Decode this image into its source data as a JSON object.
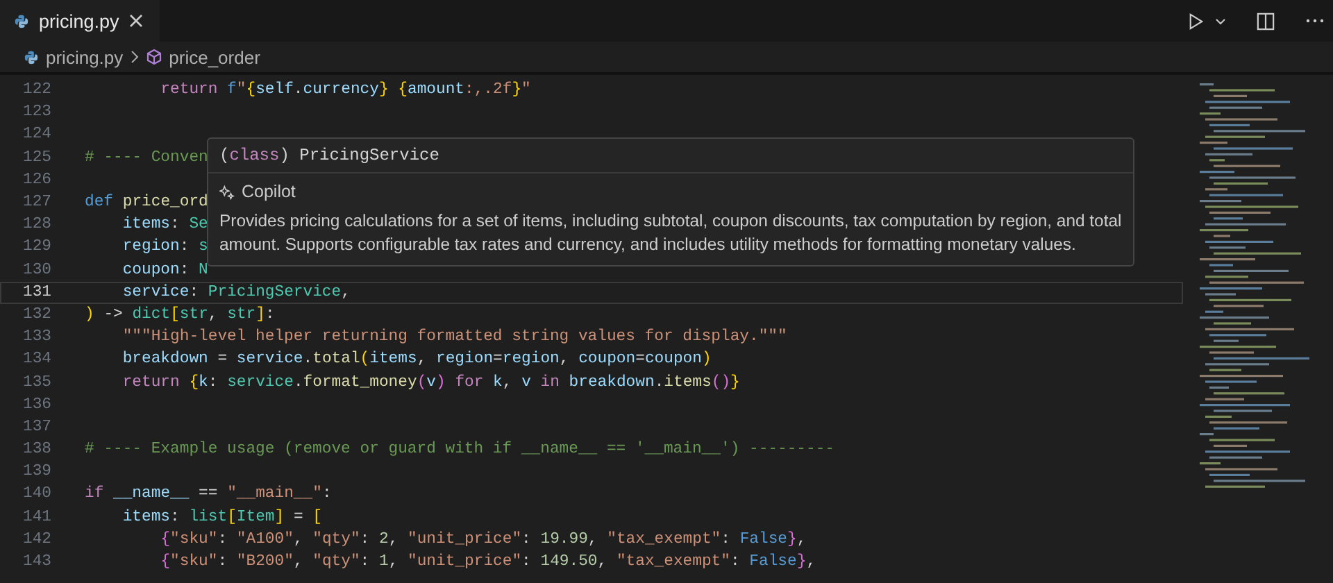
{
  "tab": {
    "label": "pricing.py",
    "selected": true
  },
  "breadcrumb": [
    {
      "kind": "file",
      "label": "pricing.py"
    },
    {
      "kind": "symbol",
      "label": "price_order"
    }
  ],
  "lines": [
    {
      "num": "122",
      "current": false,
      "text": "        return f\"{self.currency} {amount:,.2f}\""
    },
    {
      "num": "123",
      "current": false
    },
    {
      "num": "124",
      "current": false
    },
    {
      "num": "125",
      "current": false,
      "text": "# ---- Conven"
    },
    {
      "num": "126",
      "current": false
    },
    {
      "num": "127",
      "current": false,
      "text": "def price_ord"
    },
    {
      "num": "128",
      "current": false,
      "text": "    items: Se"
    },
    {
      "num": "129",
      "current": false,
      "text": "    region: s"
    },
    {
      "num": "130",
      "current": false,
      "text": "    coupon: N"
    },
    {
      "num": "131",
      "current": true,
      "text": "    service: PricingService,"
    },
    {
      "num": "132",
      "current": false,
      "text": ") -> dict[str, str]:"
    },
    {
      "num": "133",
      "current": false,
      "text": "    \"\"\"High-level helper returning formatted string values for display.\"\"\""
    },
    {
      "num": "134",
      "current": false,
      "text": "    breakdown = service.total(items, region=region, coupon=coupon)"
    },
    {
      "num": "135",
      "current": false,
      "text": "    return {k: service.format_money(v) for k, v in breakdown.items()}"
    },
    {
      "num": "136",
      "current": false
    },
    {
      "num": "137",
      "current": false
    },
    {
      "num": "138",
      "current": false,
      "text": "# ---- Example usage (remove or guard with if __name__ == '__main__') ---------"
    },
    {
      "num": "139",
      "current": false
    },
    {
      "num": "140",
      "current": false,
      "text": "if __name__ == \"__main__\":"
    },
    {
      "num": "141",
      "current": false,
      "text": "    items: list[Item] = ["
    },
    {
      "num": "142",
      "current": false,
      "text": "        {\"sku\": \"A100\", \"qty\": 2, \"unit_price\": 19.99, \"tax_exempt\": False},"
    },
    {
      "num": "143",
      "current": false,
      "text": "        {\"sku\": \"B200\", \"qty\": 1, \"unit_price\": 149.50, \"tax_exempt\": False},"
    }
  ],
  "hover": {
    "signature": "(class) PricingService",
    "source": "Copilot",
    "description": "Provides pricing calculations for a set of items, including subtotal, coupon discounts, tax computation by region, and total amount. Supports configurable tax rates and currency, and includes utility methods for formatting monetary values."
  }
}
